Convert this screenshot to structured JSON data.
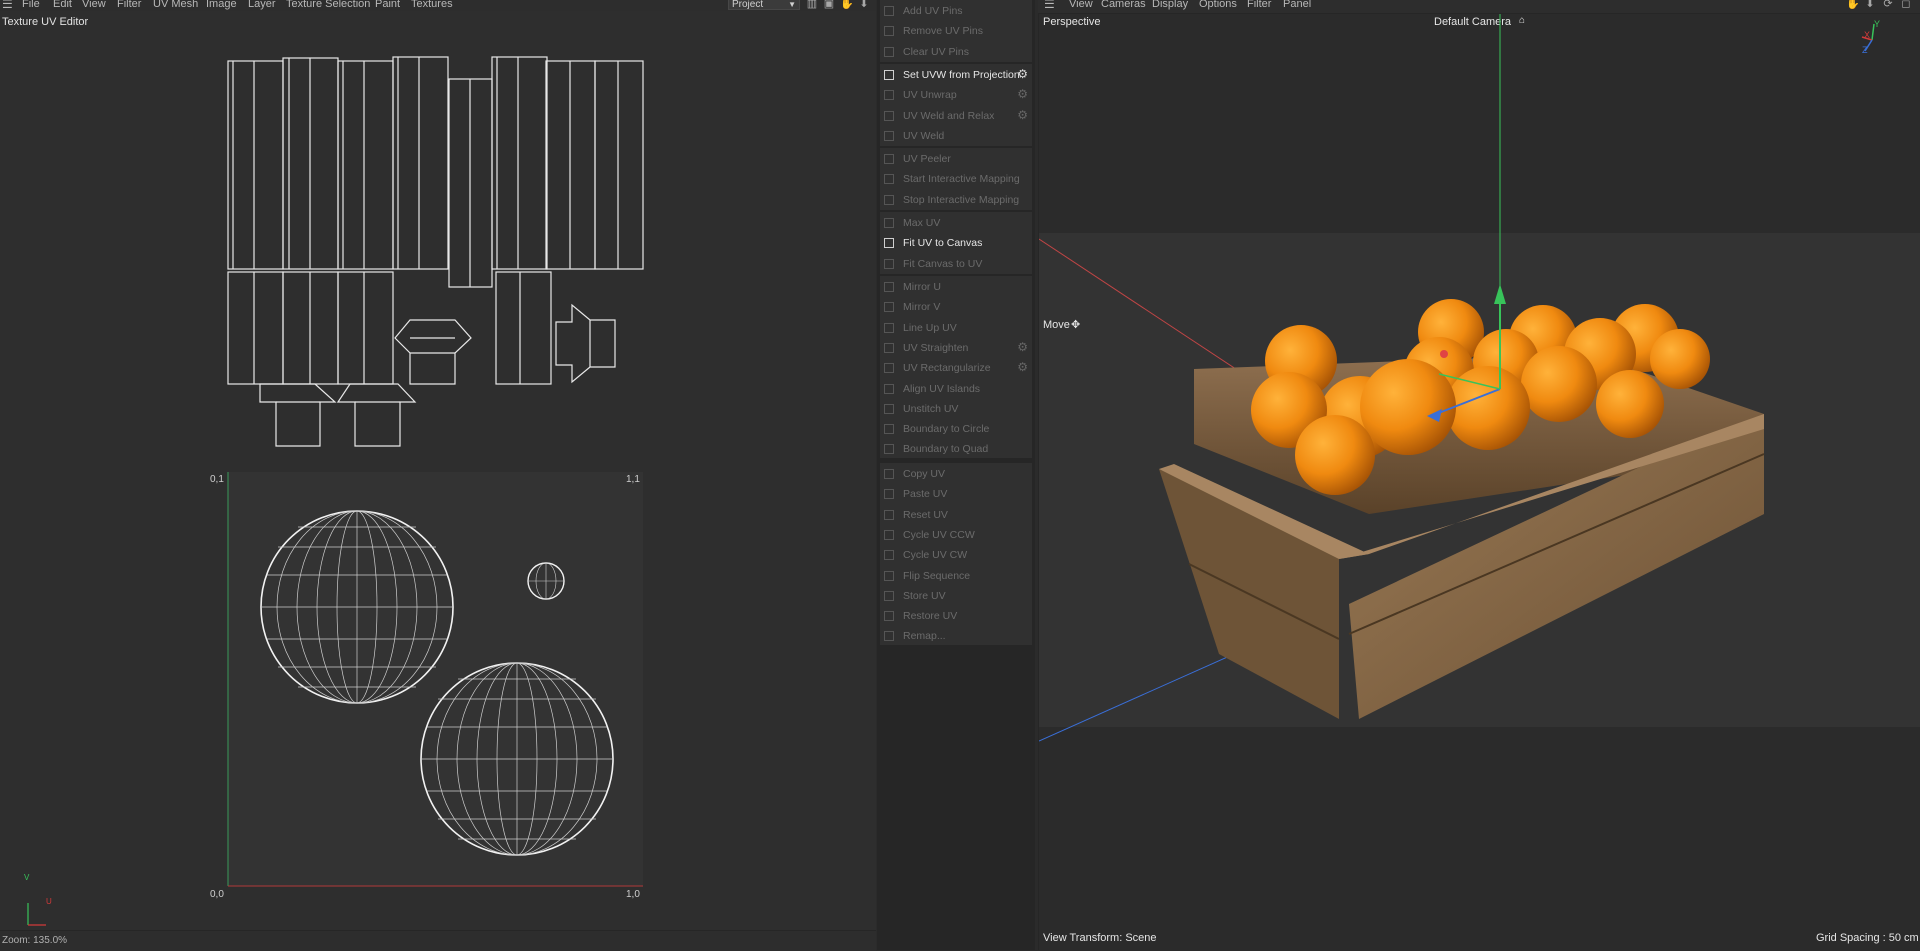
{
  "app": {
    "menu": [
      "File",
      "Edit",
      "View",
      "Filter",
      "UV Mesh",
      "Image",
      "Layer",
      "Texture Selection",
      "Paint",
      "Textures"
    ],
    "project_dropdown": "Project"
  },
  "uv_editor": {
    "title": "Texture UV Editor",
    "zoom": "Zoom: 135.0%",
    "corner_labels": {
      "top_left": "0,1",
      "top_right": "1,1",
      "bottom_left": "0,0",
      "bottom_right": "1,0"
    },
    "axis_labels": {
      "v": "V",
      "u": "U"
    }
  },
  "tool_panel": {
    "groups": [
      {
        "items": [
          {
            "label": "Add UV Pins",
            "enabled": false,
            "gear": false
          },
          {
            "label": "Remove UV Pins",
            "enabled": false,
            "gear": false
          },
          {
            "label": "Clear UV Pins",
            "enabled": false,
            "gear": false
          }
        ]
      },
      {
        "items": [
          {
            "label": "Set UVW from Projection",
            "enabled": true,
            "gear": true
          },
          {
            "label": "UV Unwrap",
            "enabled": false,
            "gear": true
          },
          {
            "label": "UV Weld and Relax",
            "enabled": false,
            "gear": true
          },
          {
            "label": "UV Weld",
            "enabled": false,
            "gear": false
          }
        ]
      },
      {
        "items": [
          {
            "label": "UV Peeler",
            "enabled": false,
            "gear": false
          },
          {
            "label": "Start Interactive Mapping",
            "enabled": false,
            "gear": false
          },
          {
            "label": "Stop Interactive Mapping",
            "enabled": false,
            "gear": false
          }
        ]
      },
      {
        "items": [
          {
            "label": "Max UV",
            "enabled": false,
            "gear": false
          },
          {
            "label": "Fit UV to Canvas",
            "enabled": true,
            "gear": false
          },
          {
            "label": "Fit Canvas to UV",
            "enabled": false,
            "gear": false
          }
        ]
      },
      {
        "items": [
          {
            "label": "Mirror U",
            "enabled": false,
            "gear": false
          },
          {
            "label": "Mirror V",
            "enabled": false,
            "gear": false
          },
          {
            "label": "Line Up UV",
            "enabled": false,
            "gear": false
          },
          {
            "label": "UV Straighten",
            "enabled": false,
            "gear": true
          },
          {
            "label": "UV Rectangularize",
            "enabled": false,
            "gear": true
          },
          {
            "label": "Align UV Islands",
            "enabled": false,
            "gear": false
          },
          {
            "label": "Unstitch UV",
            "enabled": false,
            "gear": false
          },
          {
            "label": "Boundary to Circle",
            "enabled": false,
            "gear": false
          },
          {
            "label": "Boundary to Quad",
            "enabled": false,
            "gear": false
          }
        ]
      },
      {
        "items": [
          {
            "label": "Copy UV",
            "enabled": false,
            "gear": false
          },
          {
            "label": "Paste UV",
            "enabled": false,
            "gear": false
          },
          {
            "label": "Reset UV",
            "enabled": false,
            "gear": false
          },
          {
            "label": "Cycle UV CCW",
            "enabled": false,
            "gear": false
          },
          {
            "label": "Cycle UV CW",
            "enabled": false,
            "gear": false
          },
          {
            "label": "Flip Sequence",
            "enabled": false,
            "gear": false
          },
          {
            "label": "Store UV",
            "enabled": false,
            "gear": false
          },
          {
            "label": "Restore UV",
            "enabled": false,
            "gear": false
          },
          {
            "label": "Remap...",
            "enabled": false,
            "gear": false
          }
        ]
      }
    ]
  },
  "viewport": {
    "menu": [
      "View",
      "Cameras",
      "Display",
      "Options",
      "Filter",
      "Panel"
    ],
    "projection": "Perspective",
    "camera": "Default Camera",
    "tool": "Move",
    "view_transform": "View Transform: Scene",
    "grid_spacing": "Grid Spacing : 50 cm",
    "axis_gizmo": {
      "x": "X",
      "y": "Y",
      "z": "Z"
    }
  },
  "colors": {
    "accent": "#e2e2e2",
    "x_axis": "#d23a3a",
    "y_axis": "#38c35a",
    "z_axis": "#3a6fd8",
    "orange": "#f08a10",
    "wood": "#8a6a45"
  }
}
